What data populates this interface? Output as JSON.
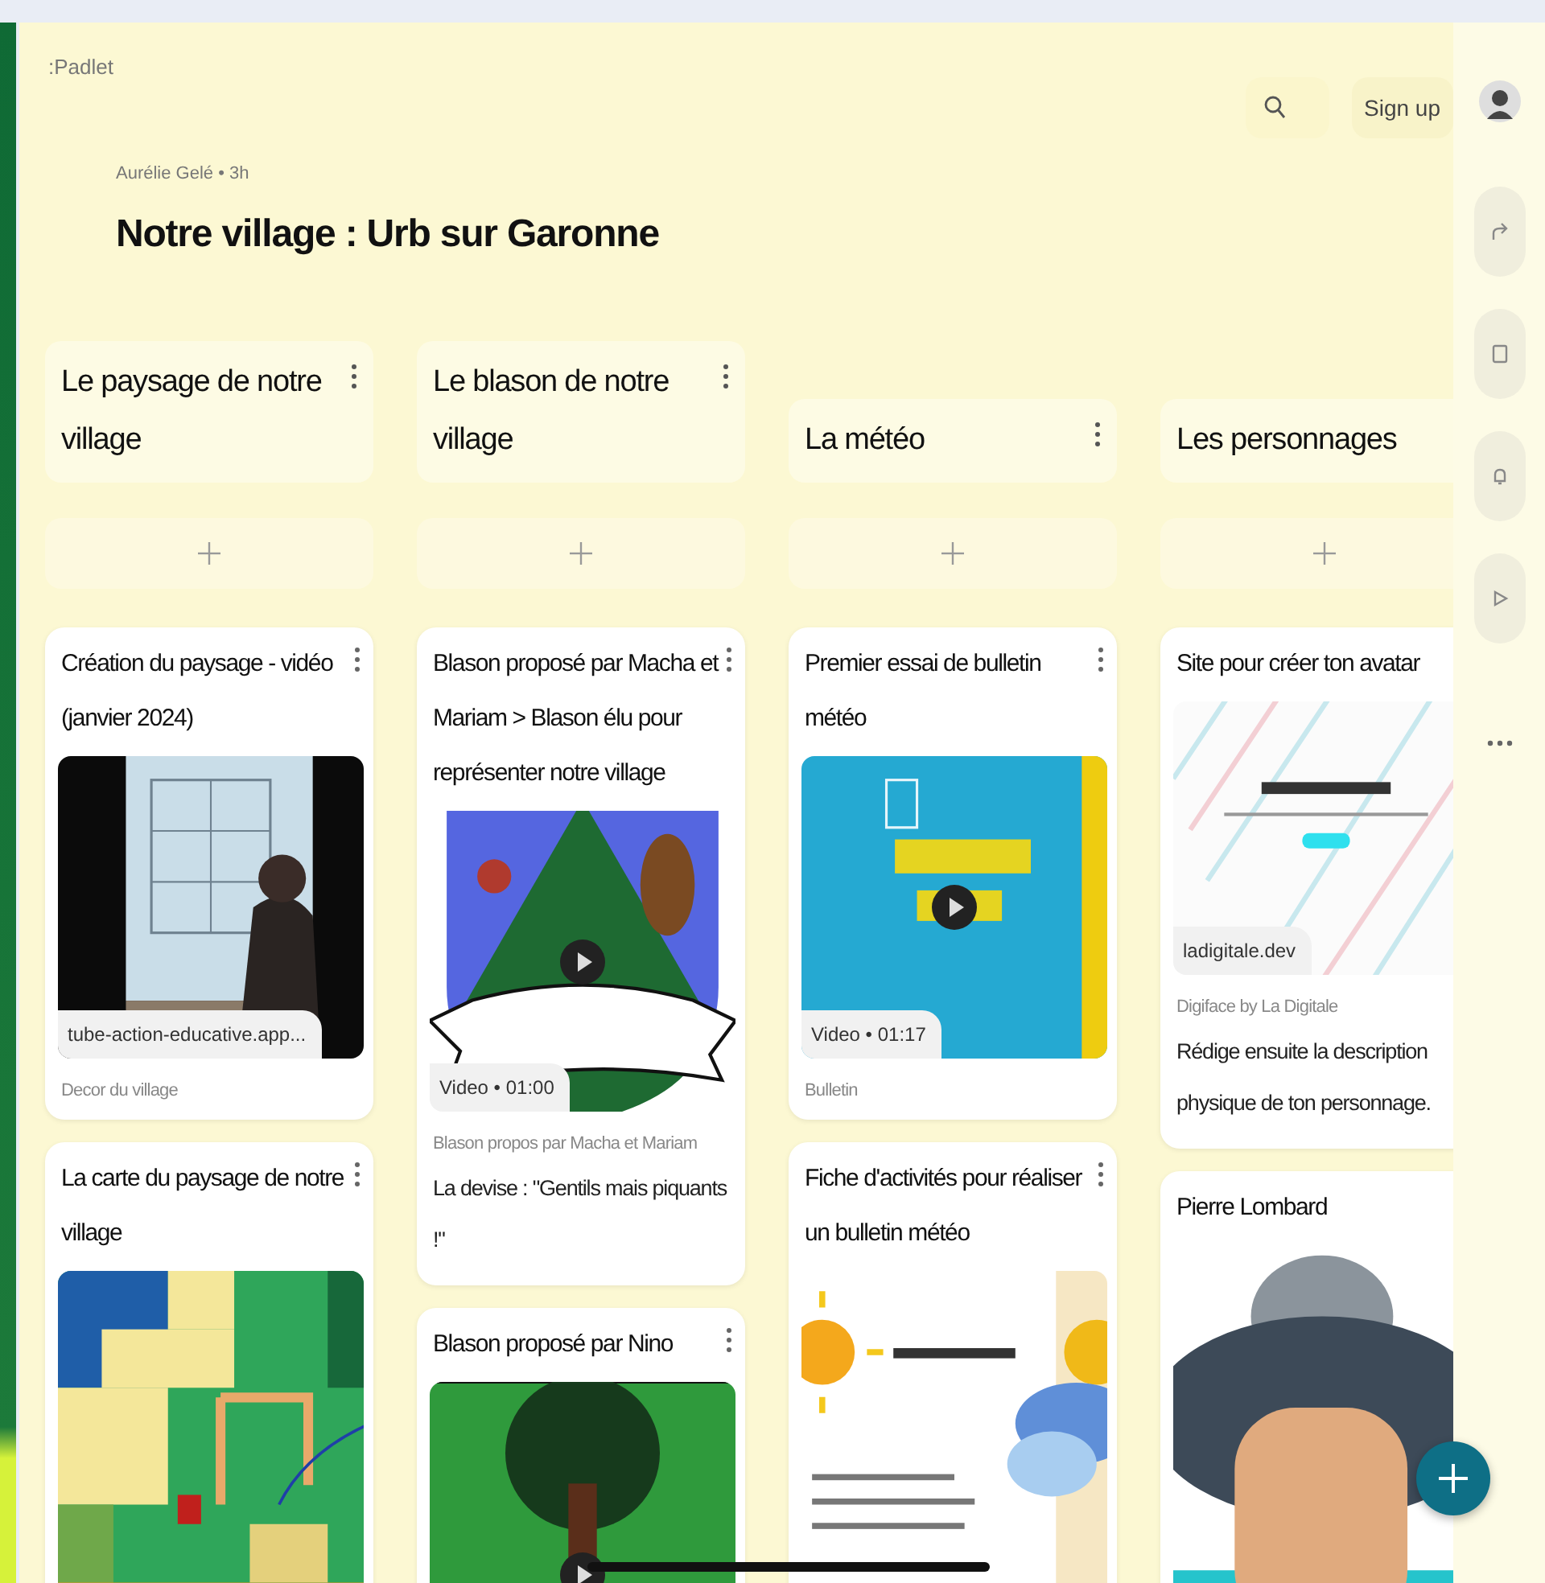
{
  "logo": ":Padlet",
  "header": {
    "byline": "Aurélie Gelé • 3h",
    "title": "Notre village : Urb sur Garonne"
  },
  "signup": "Sign up",
  "columns": [
    {
      "title": "Le paysage de notre village",
      "cards": [
        {
          "title": "Création du paysage - vidéo (janvier 2024)",
          "chip": "tube-action-educative.app...",
          "caption": "Decor du village",
          "play": false
        },
        {
          "title": "La carte du paysage de notre village",
          "play": false
        }
      ]
    },
    {
      "title": "Le blason de notre village",
      "cards": [
        {
          "title": "Blason proposé par Macha et Mariam > Blason élu pour représenter notre village",
          "chip": "Video • 01:00",
          "caption": "Blason propos par Macha et Mariam",
          "body": "La devise : \"Gentils mais piquants !\"",
          "play": true
        },
        {
          "title": "Blason proposé par Nino",
          "play": true
        }
      ]
    },
    {
      "title": "La météo",
      "cards": [
        {
          "title": "Premier essai de bulletin météo",
          "chip": "Video • 01:17",
          "caption": "Bulletin",
          "play": true
        },
        {
          "title": "Fiche d'activités pour réaliser un bulletin météo",
          "play": false
        }
      ]
    },
    {
      "title": "Les personnages",
      "cards": [
        {
          "title": "Site pour créer ton avatar",
          "chip": "ladigitale.dev",
          "caption": "Digiface by La Digitale",
          "body": "Rédige ensuite la description physique de ton personnage.",
          "play": false
        },
        {
          "title": "Pierre Lombard",
          "play": false
        }
      ]
    }
  ]
}
